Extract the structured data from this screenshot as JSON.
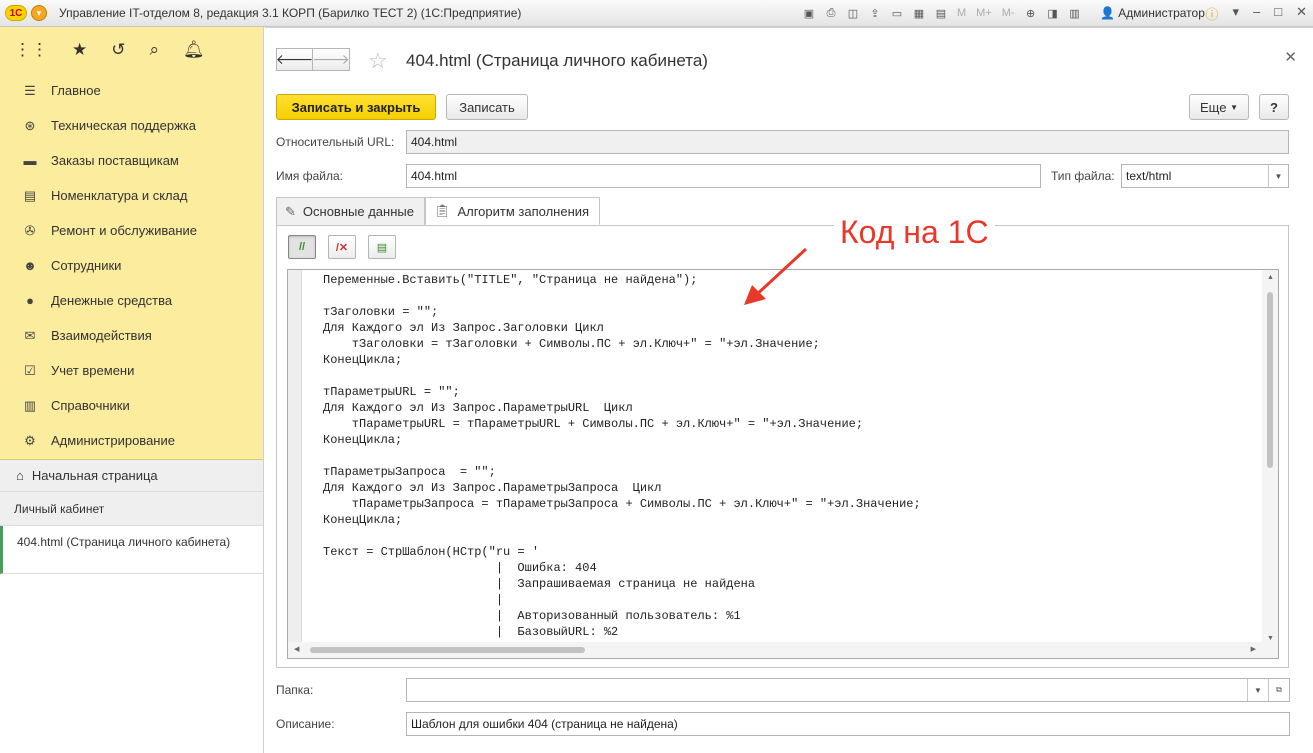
{
  "titlebar": {
    "logo": "1С",
    "title": "Управление IT-отделом 8, редакция 3.1 КОРП (Барилко ТЕСТ 2)  (1С:Предприятие)",
    "m_labels": [
      "M",
      "M+",
      "M-"
    ],
    "user": "Администратор"
  },
  "sidebar": {
    "items": [
      {
        "icon": "menu-icon",
        "glyph": "☰",
        "label": "Главное"
      },
      {
        "icon": "lifebuoy-icon",
        "glyph": "⊛",
        "label": "Техническая поддержка"
      },
      {
        "icon": "truck-icon",
        "glyph": "▬",
        "label": "Заказы поставщикам"
      },
      {
        "icon": "printer-icon",
        "glyph": "▤",
        "label": "Номенклатура и склад"
      },
      {
        "icon": "tools-icon",
        "glyph": "✇",
        "label": "Ремонт и обслуживание"
      },
      {
        "icon": "people-icon",
        "glyph": "☻",
        "label": "Сотрудники"
      },
      {
        "icon": "money-bag-icon",
        "glyph": "●",
        "label": "Денежные средства"
      },
      {
        "icon": "envelope-icon",
        "glyph": "✉",
        "label": "Взаимодействия"
      },
      {
        "icon": "calendar-check-icon",
        "glyph": "☑",
        "label": "Учет времени"
      },
      {
        "icon": "book-icon",
        "glyph": "▥",
        "label": "Справочники"
      },
      {
        "icon": "gear-icon",
        "glyph": "⚙",
        "label": "Администрирование"
      }
    ],
    "home": "Начальная страница",
    "section": "Личный кабинет",
    "open_doc": "404.html (Страница личного кабинета)"
  },
  "main": {
    "title": "404.html (Страница личного кабинета)",
    "save_close": "Записать и закрыть",
    "save": "Записать",
    "more": "Еще",
    "help": "?",
    "url_label": "Относительный URL:",
    "url_value": "404.html",
    "file_label": "Имя файла:",
    "file_value": "404.html",
    "type_label": "Тип файла:",
    "type_value": "text/html",
    "tabs": [
      "Основные данные",
      "Алгоритм заполнения"
    ],
    "folder_label": "Папка:",
    "folder_value": "",
    "desc_label": "Описание:",
    "desc_value": "Шаблон для ошибки 404 (страница не найдена)"
  },
  "code": "Переменные.Вставить(\"TITLE\", \"Страница не найдена\");\n\nтЗаголовки = \"\";\nДля Каждого эл Из Запрос.Заголовки Цикл\n    тЗаголовки = тЗаголовки + Символы.ПС + эл.Ключ+\" = \"+эл.Значение;\nКонецЦикла;\n\nтПараметрыURL = \"\";\nДля Каждого эл Из Запрос.ПараметрыURL  Цикл\n    тПараметрыURL = тПараметрыURL + Символы.ПС + эл.Ключ+\" = \"+эл.Значение;\nКонецЦикла;\n\nтПараметрыЗапроса  = \"\";\nДля Каждого эл Из Запрос.ПараметрыЗапроса  Цикл\n    тПараметрыЗапроса = тПараметрыЗапроса + Символы.ПС + эл.Ключ+\" = \"+эл.Значение;\nКонецЦикла;\n\nТекст = СтрШаблон(НСтр(\"ru = '\n                        |  Ошибка: 404\n                        |  Запрашиваемая страница не найдена\n                        |\n                        |  Авторизованный пользователь: %1\n                        |  БазовыйURL: %2",
  "annotation": "Код на 1С",
  "colors": {
    "accent": "#f5cf00",
    "sidebar": "#fbec9e",
    "annotation": "#e8382a"
  }
}
